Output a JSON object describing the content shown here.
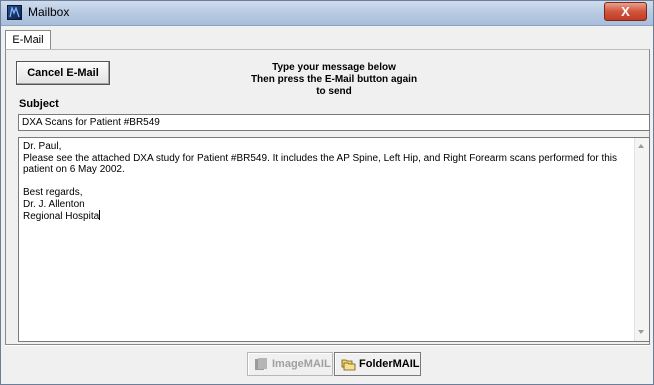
{
  "window": {
    "title": "Mailbox",
    "close_glyph": "X",
    "icon": "mailbox-app-icon"
  },
  "tabs": [
    {
      "label": "E-Mail",
      "selected": true
    }
  ],
  "toolbar": {
    "cancel_label": "Cancel E-Mail",
    "instructions": "Type your message below\nThen press the E-Mail button again\nto send"
  },
  "subject": {
    "label": "Subject",
    "value": "DXA Scans for Patient #BR549"
  },
  "message": {
    "body": "Dr. Paul,\nPlease see the attached DXA study for Patient #BR549. It includes the AP Spine, Left Hip, and Right Forearm scans performed for this\npatient on 6 May 2002.\n\nBest regards,\nDr. J. Allenton\nRegional Hospita"
  },
  "bottom_buttons": {
    "imagemail_label": "ImageMAIL",
    "imagemail_enabled": false,
    "imagemail_icon": "image-stack-icon",
    "foldermail_label": "FolderMAIL",
    "foldermail_enabled": true,
    "foldermail_icon": "folders-icon"
  },
  "colors": {
    "titlebar": "#b9cbe3",
    "close_button": "#c94a32",
    "disabled_text": "#a0a0a0"
  }
}
